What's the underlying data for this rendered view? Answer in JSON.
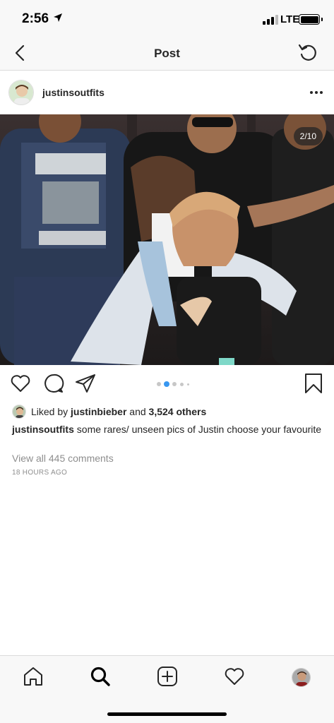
{
  "status_bar": {
    "time": "2:56",
    "network": "LTE"
  },
  "nav": {
    "title": "Post"
  },
  "post": {
    "username": "justinsoutfits",
    "image_counter": "2/10",
    "carousel": {
      "total_dots_visible": 5,
      "active_index": 1
    },
    "liked_by_prefix": "Liked by",
    "liked_by_user": "justinbieber",
    "liked_by_and": "and",
    "liked_by_others": "3,524 others",
    "caption_user": "justinsoutfits",
    "caption_text": "some rares/ unseen pics of Justin choose your favourite",
    "view_comments": "View all 445 comments",
    "time_ago": "18 HOURS AGO"
  },
  "icons": {
    "status": [
      "location-arrow-icon",
      "signal-icon",
      "battery-icon"
    ],
    "nav": [
      "back-icon",
      "refresh-icon"
    ],
    "actions": [
      "heart-icon",
      "comment-icon",
      "share-icon",
      "bookmark-icon"
    ],
    "tabs": [
      "home-icon",
      "search-icon",
      "add-icon",
      "activity-icon",
      "profile-avatar"
    ]
  },
  "colors": {
    "accent": "#3897f0",
    "text": "#262626",
    "muted": "#8e8e8e",
    "divider": "#dbdbdb"
  }
}
